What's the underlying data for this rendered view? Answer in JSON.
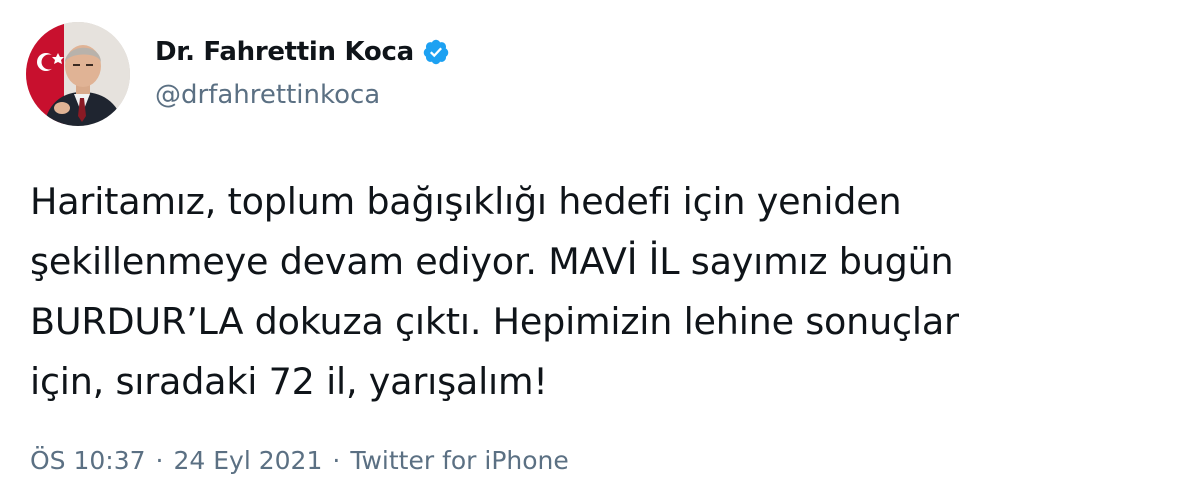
{
  "author": {
    "display_name": "Dr. Fahrettin Koca",
    "handle": "@drfahrettinkoca",
    "verified": true,
    "verified_color": "#1da1f2"
  },
  "tweet": {
    "text": "Haritamız, toplum bağışıklığı hedefi için yeniden\nşekillenmeye devam ediyor. MAVİ İL sayımız bugün\nBURDUR’LA dokuza çıktı. Hepimizin lehine sonuçlar\niçin, sıradaki 72 il, yarışalım!"
  },
  "meta": {
    "time": "ÖS 10:37",
    "separator": "·",
    "date": "24 Eyl 2021",
    "source": "Twitter for iPhone"
  },
  "colors": {
    "text": "#0f1419",
    "secondary": "#5b7083",
    "background": "#ffffff"
  }
}
